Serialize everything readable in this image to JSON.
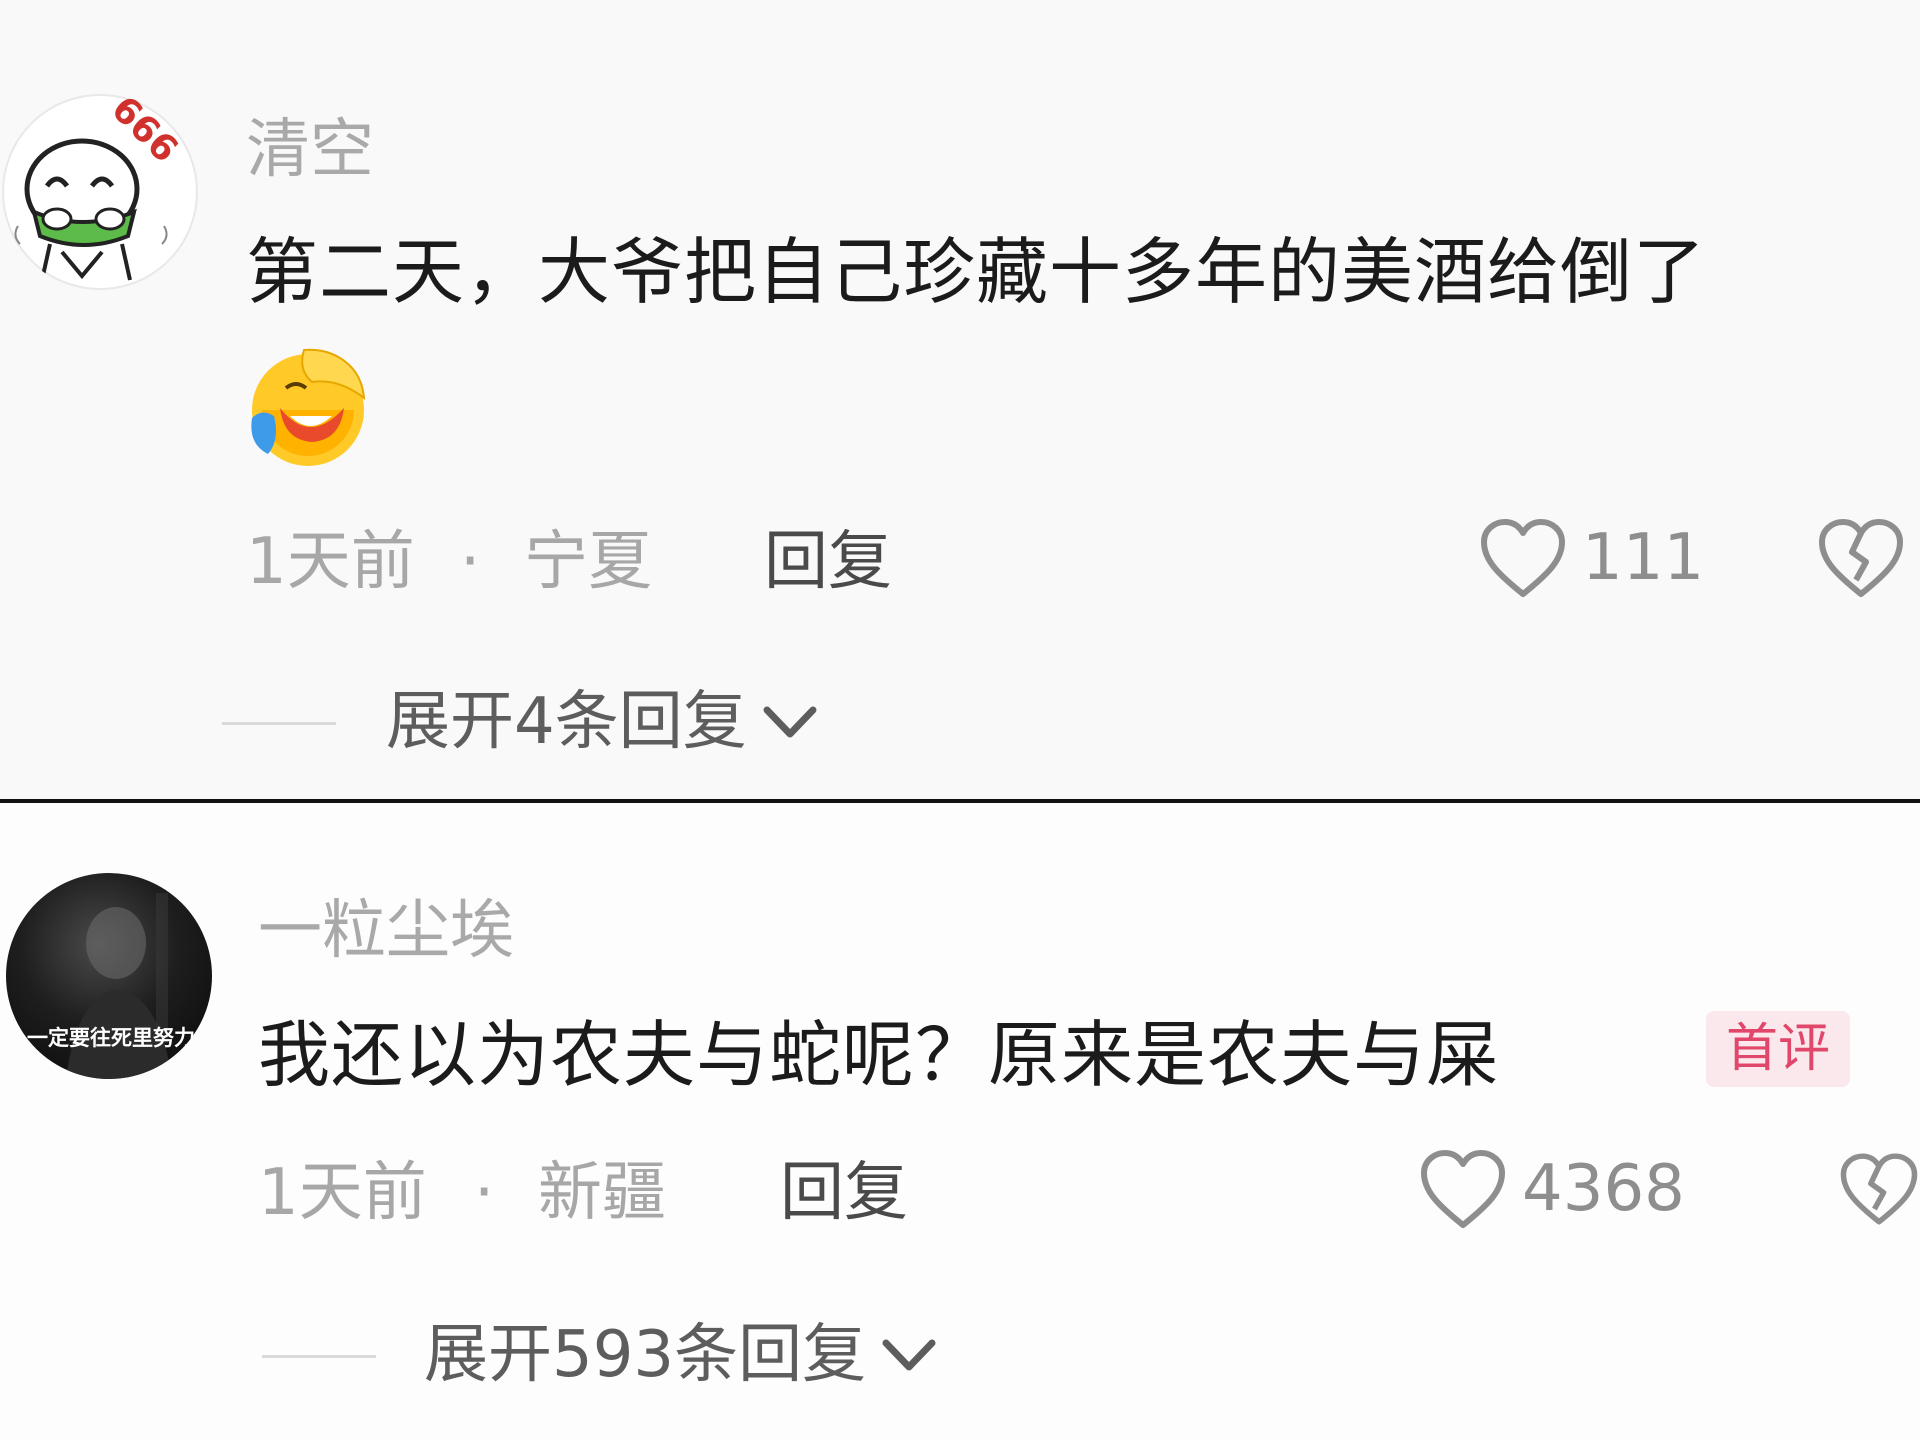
{
  "comments": [
    {
      "username": "清空",
      "avatar_badge": "666",
      "avatar_icon": "cartoon-character-icon",
      "text": "第二天，大爷把自己珍藏十多年的美酒给倒了",
      "emoji": "crying-laughing-face-icon",
      "time": "1天前",
      "separator": "·",
      "location": "宁夏",
      "reply_label": "回复",
      "likes": "111",
      "expand_label": "展开4条回复"
    },
    {
      "username": "一粒尘埃",
      "avatar_caption": "一定要往死里努力",
      "avatar_icon": "dark-portrait-icon",
      "text": "我还以为农夫与蛇呢？原来是农夫与屎",
      "badge": "首评",
      "time": "1天前",
      "separator": "·",
      "location": "新疆",
      "reply_label": "回复",
      "likes": "4368",
      "expand_label": "展开593条回复"
    }
  ],
  "colors": {
    "badge_text": "#e0476a",
    "badge_bg": "#fbe8ec",
    "username": "#a9a9a9",
    "meta": "#a7a7a7",
    "body": "#1b1b1b"
  }
}
